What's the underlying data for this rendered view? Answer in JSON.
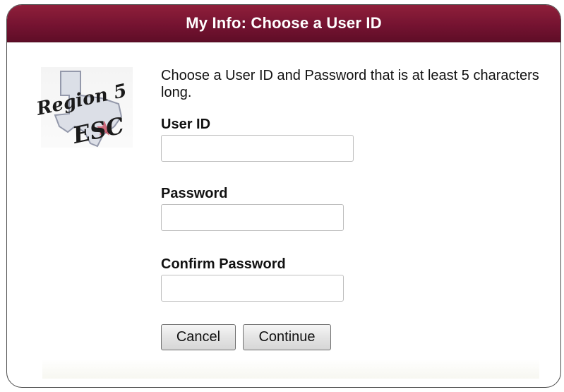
{
  "dialog": {
    "title": "My Info: Choose a User ID",
    "intro": "Choose a User ID and Password that is at least 5 characters long.",
    "logo": {
      "line1": "Region 5",
      "line2": "ESC",
      "icon": "texas-state-outline"
    },
    "fields": {
      "user_id": {
        "label": "User ID",
        "value": "",
        "placeholder": ""
      },
      "password": {
        "label": "Password",
        "value": "",
        "placeholder": ""
      },
      "confirm_password": {
        "label": "Confirm Password",
        "value": "",
        "placeholder": ""
      }
    },
    "buttons": {
      "cancel": "Cancel",
      "continue": "Continue"
    }
  },
  "colors": {
    "title_bar": "#751331",
    "title_text": "#ffffff"
  }
}
